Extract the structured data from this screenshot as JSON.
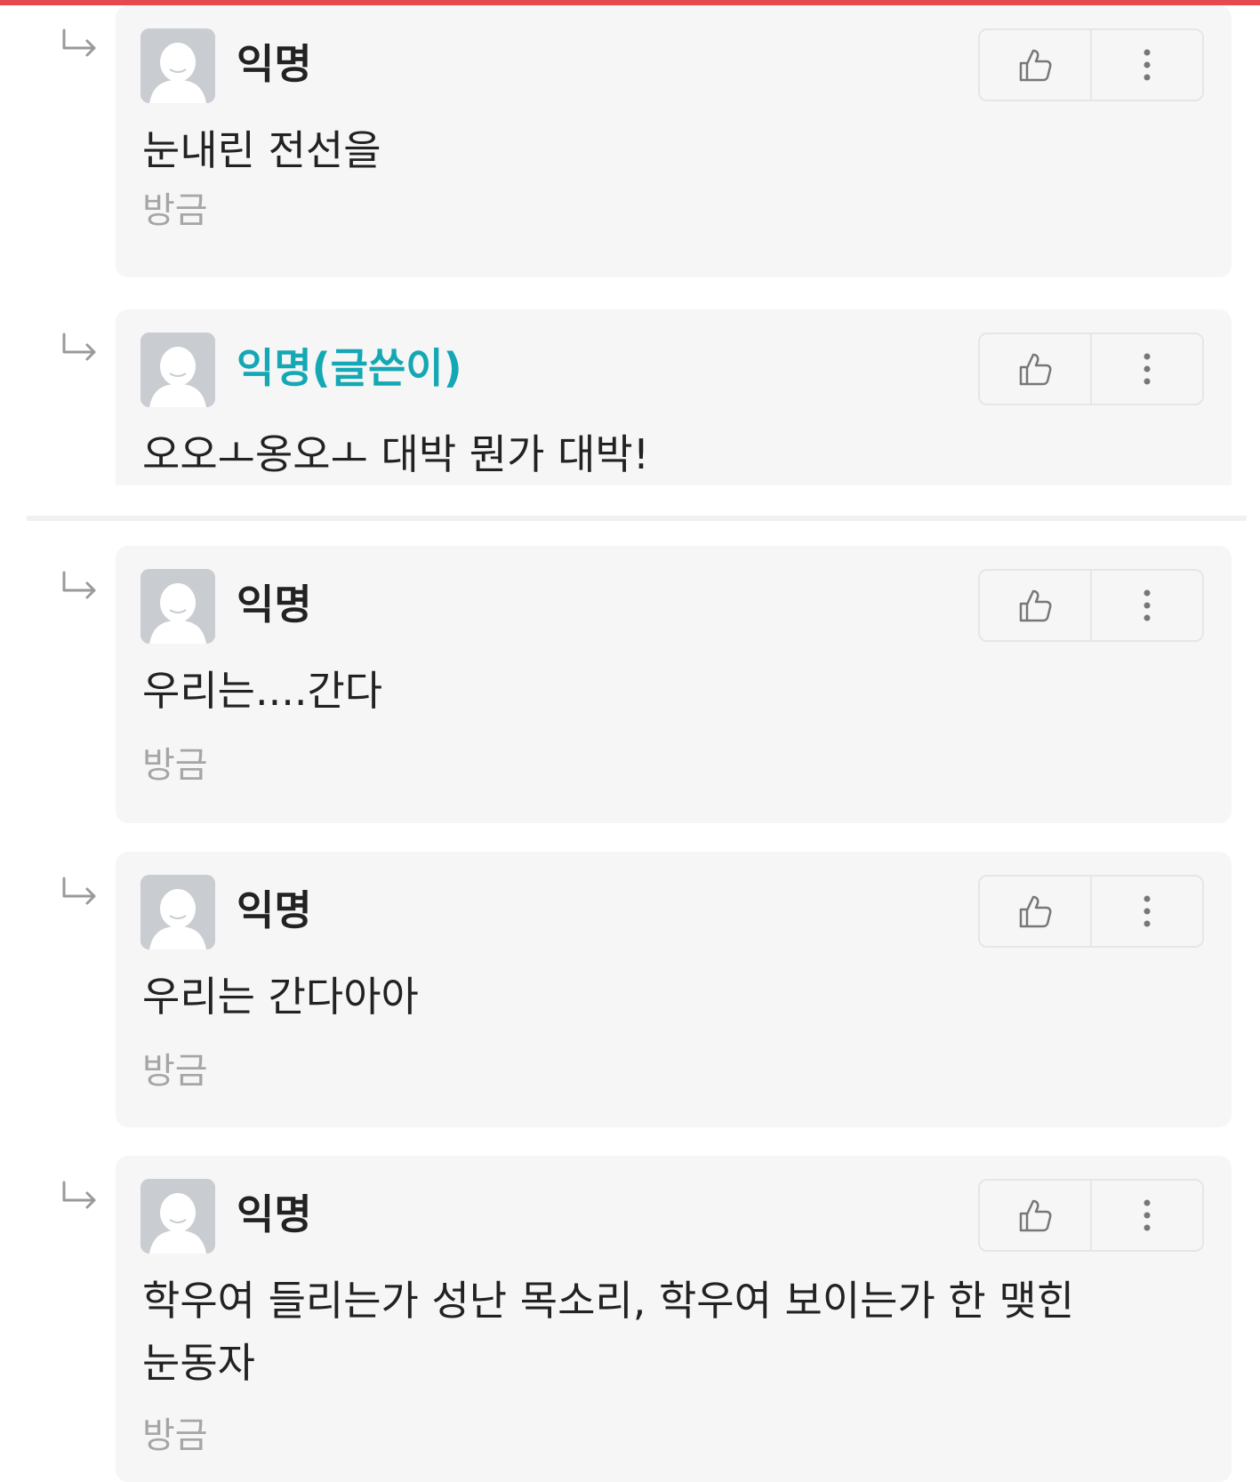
{
  "comments": [
    {
      "author": "익명",
      "is_op": false,
      "text": "눈내린 전선을",
      "time": "방금"
    },
    {
      "author": "익명(글쓴이)",
      "is_op": true,
      "text": "오오ㅗ옹오ㅗ 대박 뭔가 대박!",
      "time": ""
    },
    {
      "author": "익명",
      "is_op": false,
      "text": "우리는....간다",
      "time": "방금"
    },
    {
      "author": "익명",
      "is_op": false,
      "text": "우리는 간다아아",
      "time": "방금"
    },
    {
      "author": "익명",
      "is_op": false,
      "text": "학우여 들리는가 성난 목소리, 학우여 보이는가 한 맺힌\n눈동자",
      "time": "방금"
    }
  ],
  "icons": {
    "reply": "reply-arrow-icon",
    "avatar": "default-avatar-icon",
    "like": "thumbs-up-icon",
    "more": "more-vertical-icon"
  },
  "colors": {
    "top_bar": "#e5484d",
    "op_author": "#14a8b5",
    "card_bg": "#f6f6f6",
    "timestamp": "#a6a6a6"
  }
}
